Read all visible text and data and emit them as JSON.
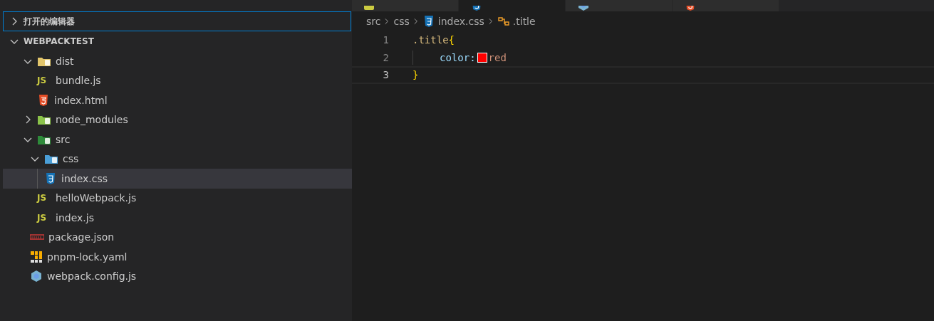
{
  "sidebar": {
    "open_editors": {
      "label": "打开的编辑器",
      "expanded": false
    },
    "project": {
      "label": "WEBPACKTEST",
      "expanded": true
    },
    "tree": [
      {
        "name": "dist",
        "kind": "folder-dist",
        "expanded": true,
        "selected": false,
        "children": [
          {
            "name": "bundle.js",
            "kind": "js",
            "badge": "JS",
            "selected": false
          },
          {
            "name": "index.html",
            "kind": "html",
            "selected": false
          }
        ]
      },
      {
        "name": "node_modules",
        "kind": "folder-node",
        "expanded": false,
        "selected": false
      },
      {
        "name": "src",
        "kind": "folder-src",
        "expanded": true,
        "selected": false,
        "children": [
          {
            "name": "css",
            "kind": "folder-css",
            "expanded": true,
            "selected": false,
            "children": [
              {
                "name": "index.css",
                "kind": "css",
                "selected": true
              }
            ]
          },
          {
            "name": "helloWebpack.js",
            "kind": "js",
            "badge": "JS",
            "selected": false
          },
          {
            "name": "index.js",
            "kind": "js",
            "badge": "JS",
            "selected": false
          }
        ]
      },
      {
        "name": "package.json",
        "kind": "npm",
        "selected": false
      },
      {
        "name": "pnpm-lock.yaml",
        "kind": "pnpm",
        "selected": false
      },
      {
        "name": "webpack.config.js",
        "kind": "webpack",
        "selected": false
      }
    ]
  },
  "tabs": [
    {
      "kind": "js",
      "selected": false
    },
    {
      "kind": "css",
      "selected": true
    },
    {
      "kind": "webpack",
      "selected": false
    },
    {
      "kind": "html",
      "selected": false
    }
  ],
  "breadcrumb": [
    {
      "text": "src",
      "kind": "folder"
    },
    {
      "text": "css",
      "kind": "folder"
    },
    {
      "text": "index.css",
      "kind": "css"
    },
    {
      "text": ".title",
      "kind": "selector"
    }
  ],
  "code": [
    {
      "number": "1",
      "current": false,
      "tokens": [
        {
          "kind": "selector",
          "text": ".title"
        },
        {
          "kind": "brace",
          "text": "{"
        }
      ]
    },
    {
      "number": "2",
      "current": false,
      "tokens": [
        {
          "kind": "indent"
        },
        {
          "kind": "property",
          "text": "color:"
        },
        {
          "kind": "swatch",
          "color": "#ff0000"
        },
        {
          "kind": "value",
          "text": "red"
        }
      ]
    },
    {
      "number": "3",
      "current": true,
      "tokens": [
        {
          "kind": "brace",
          "text": "}"
        }
      ]
    }
  ]
}
